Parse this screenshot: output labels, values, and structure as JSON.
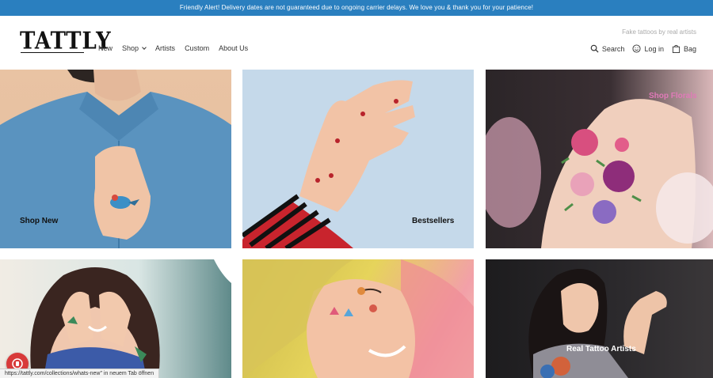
{
  "alert": {
    "text": "Friendly Alert! Delivery dates are not guaranteed due to ongoing carrier delays. We love you & thank you for your patience!"
  },
  "header": {
    "logo": "TATTLY",
    "tagline": "Fake tattoos by real artists",
    "nav": [
      {
        "label": "New"
      },
      {
        "label": "Shop"
      },
      {
        "label": "Artists"
      },
      {
        "label": "Custom"
      },
      {
        "label": "About Us"
      }
    ],
    "utils": {
      "search": "Search",
      "login": "Log in",
      "bag": "Bag"
    }
  },
  "tiles": [
    {
      "label": "Shop New"
    },
    {
      "label": "Bestsellers"
    },
    {
      "label": "Shop Florals"
    },
    {
      "label": ""
    },
    {
      "label": ""
    },
    {
      "label": "Real Tattoo Artists"
    }
  ],
  "status_bar": {
    "text": "https://tattly.com/collections/whats-new\" in neuem Tab öffnen"
  },
  "colors": {
    "alert_bg": "#2a7fbf",
    "florals_label": "#e07ab8"
  }
}
